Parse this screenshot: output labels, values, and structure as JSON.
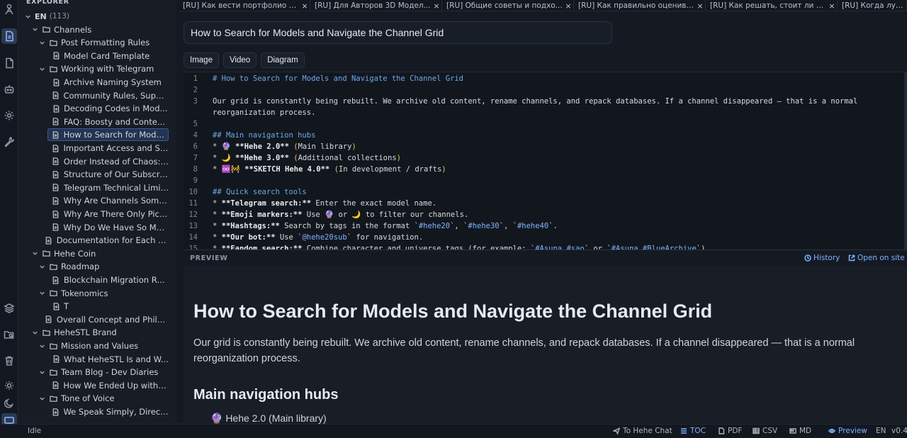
{
  "explorer": {
    "title": "EXPLORER",
    "root": {
      "label": "EN",
      "count": "(113)"
    },
    "items": [
      {
        "label": "Channels",
        "kind": "folder",
        "expanded": true
      },
      {
        "label": "Post Formatting Rules",
        "kind": "folder",
        "expanded": true
      },
      {
        "label": "Model Card Template",
        "kind": "file"
      },
      {
        "label": "Working with Telegram",
        "kind": "folder",
        "expanded": true
      },
      {
        "label": "Archive Naming System",
        "kind": "file"
      },
      {
        "label": "Community Rules, Suppo...",
        "kind": "file"
      },
      {
        "label": "Decoding Codes in Mod...",
        "kind": "file"
      },
      {
        "label": "FAQ: Boosty and Conten...",
        "kind": "file"
      },
      {
        "label": "How to Search for Model...",
        "kind": "file",
        "selected": true
      },
      {
        "label": "Important Access and Su...",
        "kind": "file"
      },
      {
        "label": "Order Instead of Chaos: ...",
        "kind": "file"
      },
      {
        "label": "Structure of Our Subscri...",
        "kind": "file"
      },
      {
        "label": "Telegram Technical Limit...",
        "kind": "file"
      },
      {
        "label": "Why Are Channels Some...",
        "kind": "file"
      },
      {
        "label": "Why Are There Only Pict...",
        "kind": "file"
      },
      {
        "label": "Why Do We Have So Man...",
        "kind": "file"
      },
      {
        "label": "Documentation for Each C...",
        "kind": "file"
      },
      {
        "label": "Hehe Coin",
        "kind": "folder",
        "expanded": true
      },
      {
        "label": "Roadmap",
        "kind": "folder",
        "expanded": true
      },
      {
        "label": "Blockchain Migration Ro...",
        "kind": "file"
      },
      {
        "label": "Tokenomics",
        "kind": "folder",
        "expanded": true
      },
      {
        "label": "T",
        "kind": "file"
      },
      {
        "label": "Overall Concept and Philo...",
        "kind": "file"
      },
      {
        "label": "HeheSTL Brand",
        "kind": "folder",
        "expanded": true
      },
      {
        "label": "Mission and Values",
        "kind": "folder",
        "expanded": true
      },
      {
        "label": "What HeheSTL Is and W...",
        "kind": "file"
      },
      {
        "label": "Team Blog - Dev Diaries",
        "kind": "folder",
        "expanded": true
      },
      {
        "label": "How We Ended Up with H...",
        "kind": "file"
      },
      {
        "label": "Tone of Voice",
        "kind": "folder",
        "expanded": true
      },
      {
        "label": "We Speak Simply, Directl...",
        "kind": "file"
      }
    ]
  },
  "tabs": [
    {
      "label": "[RU] Как вести портфолио а...",
      "close": "×"
    },
    {
      "label": "[RU] Для Авторов 3D Модел...",
      "close": "×"
    },
    {
      "label": "[RU] Общие советы и подхо...",
      "close": "×"
    },
    {
      "label": "[RU] Как правильно оценива...",
      "close": "×"
    },
    {
      "label": "[RU] Как решать, стоит ли д...",
      "close": "×"
    },
    {
      "label": "[RU] Когда лучше в",
      "close": ""
    }
  ],
  "editor": {
    "title_value": "How to Search for Models and Navigate the Channel Grid",
    "insert_buttons": [
      "Image",
      "Video",
      "Diagram"
    ],
    "lines": [
      {
        "n": "1",
        "parts": [
          {
            "c": "h",
            "t": "# How to Search for Models and Navigate the Channel Grid"
          }
        ]
      },
      {
        "n": "2",
        "parts": []
      },
      {
        "n": "3",
        "parts": [
          {
            "c": "",
            "t": "Our grid is constantly being rebuilt. We archive old content, rename channels, and repack databases. If a channel disappeared — that is a normal"
          }
        ]
      },
      {
        "n": "",
        "parts": [
          {
            "c": "",
            "t": "reorganization process."
          }
        ]
      },
      {
        "n": "5",
        "parts": []
      },
      {
        "n": "4",
        "parts": [
          {
            "c": "h",
            "t": "## Main navigation hubs"
          }
        ]
      },
      {
        "n": "6",
        "parts": [
          {
            "c": "",
            "t": "* 🔮 "
          },
          {
            "c": "b",
            "t": "**Hehe 2.0**"
          },
          {
            "c": "",
            "t": " "
          },
          {
            "c": "p",
            "t": "("
          },
          {
            "c": "",
            "t": "Main library"
          },
          {
            "c": "p",
            "t": ")"
          }
        ]
      },
      {
        "n": "7",
        "parts": [
          {
            "c": "",
            "t": "* 🌙 "
          },
          {
            "c": "b",
            "t": "**Hehe 3.0**"
          },
          {
            "c": "",
            "t": " "
          },
          {
            "c": "p",
            "t": "("
          },
          {
            "c": "",
            "t": "Additional collections"
          },
          {
            "c": "p",
            "t": ")"
          }
        ]
      },
      {
        "n": "8",
        "parts": [
          {
            "c": "",
            "t": "* ♾️🚧 "
          },
          {
            "c": "b",
            "t": "**SKETCH Hehe 4.0**"
          },
          {
            "c": "",
            "t": " "
          },
          {
            "c": "p",
            "t": "("
          },
          {
            "c": "",
            "t": "In development / drafts"
          },
          {
            "c": "p",
            "t": ")"
          }
        ]
      },
      {
        "n": "9",
        "parts": []
      },
      {
        "n": "10",
        "parts": [
          {
            "c": "h",
            "t": "## Quick search tools"
          }
        ]
      },
      {
        "n": "11",
        "parts": [
          {
            "c": "",
            "t": "* "
          },
          {
            "c": "b",
            "t": "**Telegram search:**"
          },
          {
            "c": "",
            "t": " Enter the exact model name."
          }
        ]
      },
      {
        "n": "12",
        "parts": [
          {
            "c": "",
            "t": "* "
          },
          {
            "c": "b",
            "t": "**Emoji markers:**"
          },
          {
            "c": "",
            "t": " Use 🔮 or 🌙 to filter our channels."
          }
        ]
      },
      {
        "n": "13",
        "parts": [
          {
            "c": "",
            "t": "* "
          },
          {
            "c": "b",
            "t": "**Hashtags:**"
          },
          {
            "c": "",
            "t": " Search by tags in the format `"
          },
          {
            "c": "t",
            "t": "#hehe20"
          },
          {
            "c": "",
            "t": "`, `"
          },
          {
            "c": "t",
            "t": "#hehe30"
          },
          {
            "c": "",
            "t": "`, `"
          },
          {
            "c": "t",
            "t": "#hehe40"
          },
          {
            "c": "",
            "t": "`."
          }
        ]
      },
      {
        "n": "14",
        "parts": [
          {
            "c": "",
            "t": "* "
          },
          {
            "c": "b",
            "t": "**Our bot:**"
          },
          {
            "c": "",
            "t": " Use `"
          },
          {
            "c": "t",
            "t": "@hehe20sub"
          },
          {
            "c": "",
            "t": "` for navigation."
          }
        ]
      },
      {
        "n": "15",
        "parts": [
          {
            "c": "",
            "t": "* "
          },
          {
            "c": "b",
            "t": "**Fandom search:**"
          },
          {
            "c": "",
            "t": " Combine character and universe tags (for example: `"
          },
          {
            "c": "t",
            "t": "#Asuna #sao"
          },
          {
            "c": "",
            "t": "` or `"
          },
          {
            "c": "t",
            "t": "#Asuna #BlueArchive"
          },
          {
            "c": "",
            "t": "`)"
          }
        ]
      }
    ]
  },
  "preview": {
    "label": "PREVIEW",
    "history_label": "History",
    "open_label": "Open on site",
    "h1": "How to Search for Models and Navigate the Channel Grid",
    "paragraph": "Our grid is constantly being rebuilt. We archive old content, rename channels, and repack databases. If a channel disappeared — that is a normal reorganization process.",
    "h2": "Main navigation hubs",
    "first_item": "🔮 Hehe 2.0 (Main library)"
  },
  "status": {
    "state": "Idle",
    "to_chat": "To Hehe Chat",
    "toc": "TOC",
    "pdf": "PDF",
    "csv": "CSV",
    "md": "MD",
    "preview": "Preview",
    "lang": "EN",
    "version": "v0.4"
  },
  "colors": {
    "accent": "#7fb0ff",
    "background": "#151a22",
    "selected": "#233452"
  }
}
